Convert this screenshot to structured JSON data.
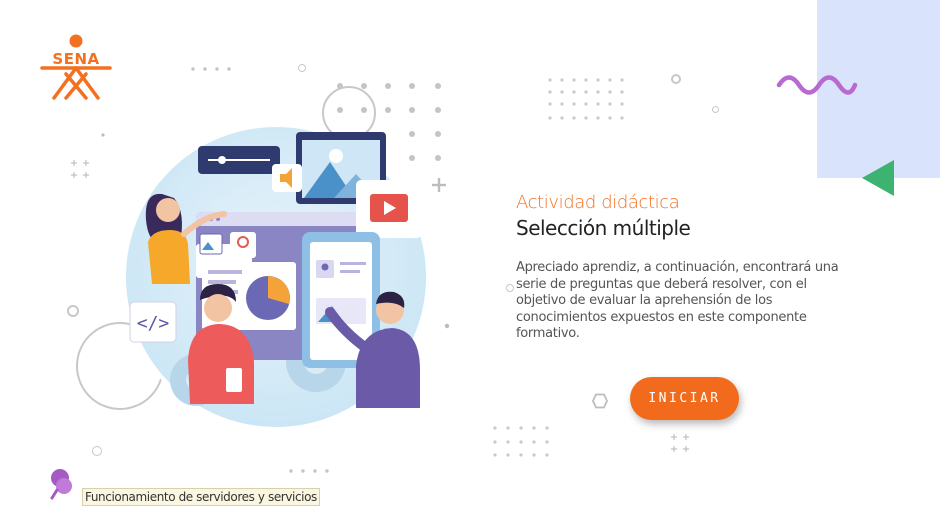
{
  "brand": {
    "logo_text": "SENA",
    "color": "#f37021"
  },
  "activity": {
    "type_label": "Actividad didáctica",
    "title": "Selección múltiple",
    "description": "Apreciado aprendiz, a continuación, encontrará una serie de preguntas que deberá resolver, con el objetivo de evaluar la aprehensión de los conocimientos expuestos en este componente formativo."
  },
  "actions": {
    "start_label": "INICIAR"
  },
  "footer": {
    "component_name": "Funcionamiento de servidores y servicios"
  },
  "colors": {
    "accent_orange": "#f26b1d",
    "panel_blue": "#d9e3fb",
    "triangle_green": "#3cb371",
    "wave_purple": "#b86ad0"
  },
  "icons": [
    "sena-logo",
    "wave-icon",
    "triangle-icon",
    "pushpin-icon",
    "hexagon-icon",
    "plus-icon"
  ]
}
